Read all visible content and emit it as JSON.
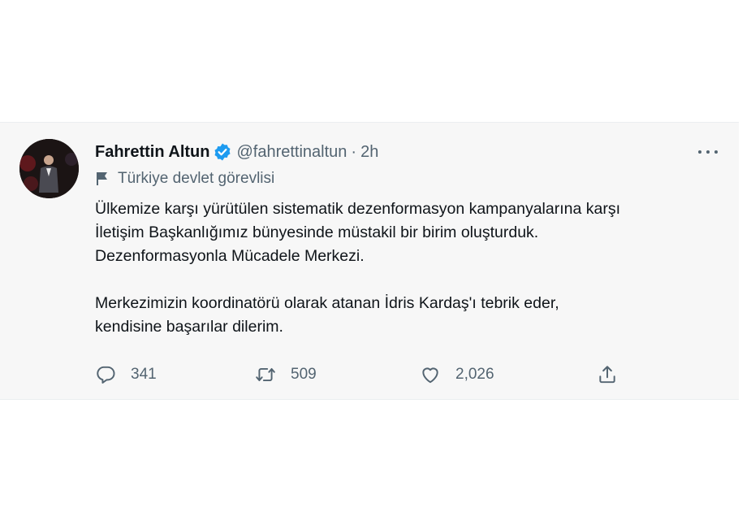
{
  "tweet": {
    "author_name": "Fahrettin Altun",
    "handle": "@fahrettinaltun",
    "separator": "·",
    "time": "2h",
    "account_label": "Türkiye devlet görevlisi",
    "body_lines": [
      "Ülkemize karşı yürütülen sistematik dezenformasyon kampanyalarına karşı",
      "İletişim Başkanlığımız bünyesinde müstakil bir birim oluşturduk.",
      "Dezenformasyonla Mücadele Merkezi.",
      "Merkezimizin koordinatörü olarak atanan İdris Kardaş'ı tebrik eder,",
      "kendisine başarılar dilerim."
    ],
    "stats": {
      "replies": "341",
      "retweets": "509",
      "likes": "2,026"
    },
    "icons": {
      "verified": "verified-badge-icon",
      "more": "more-icon",
      "label": "flag-icon",
      "reply": "reply-icon",
      "retweet": "retweet-icon",
      "like": "heart-icon",
      "share": "share-icon"
    },
    "colors": {
      "verified": "#1d9bf0",
      "text": "#0f1419",
      "secondary": "#536471",
      "card_background": "#f7f7f7"
    }
  }
}
